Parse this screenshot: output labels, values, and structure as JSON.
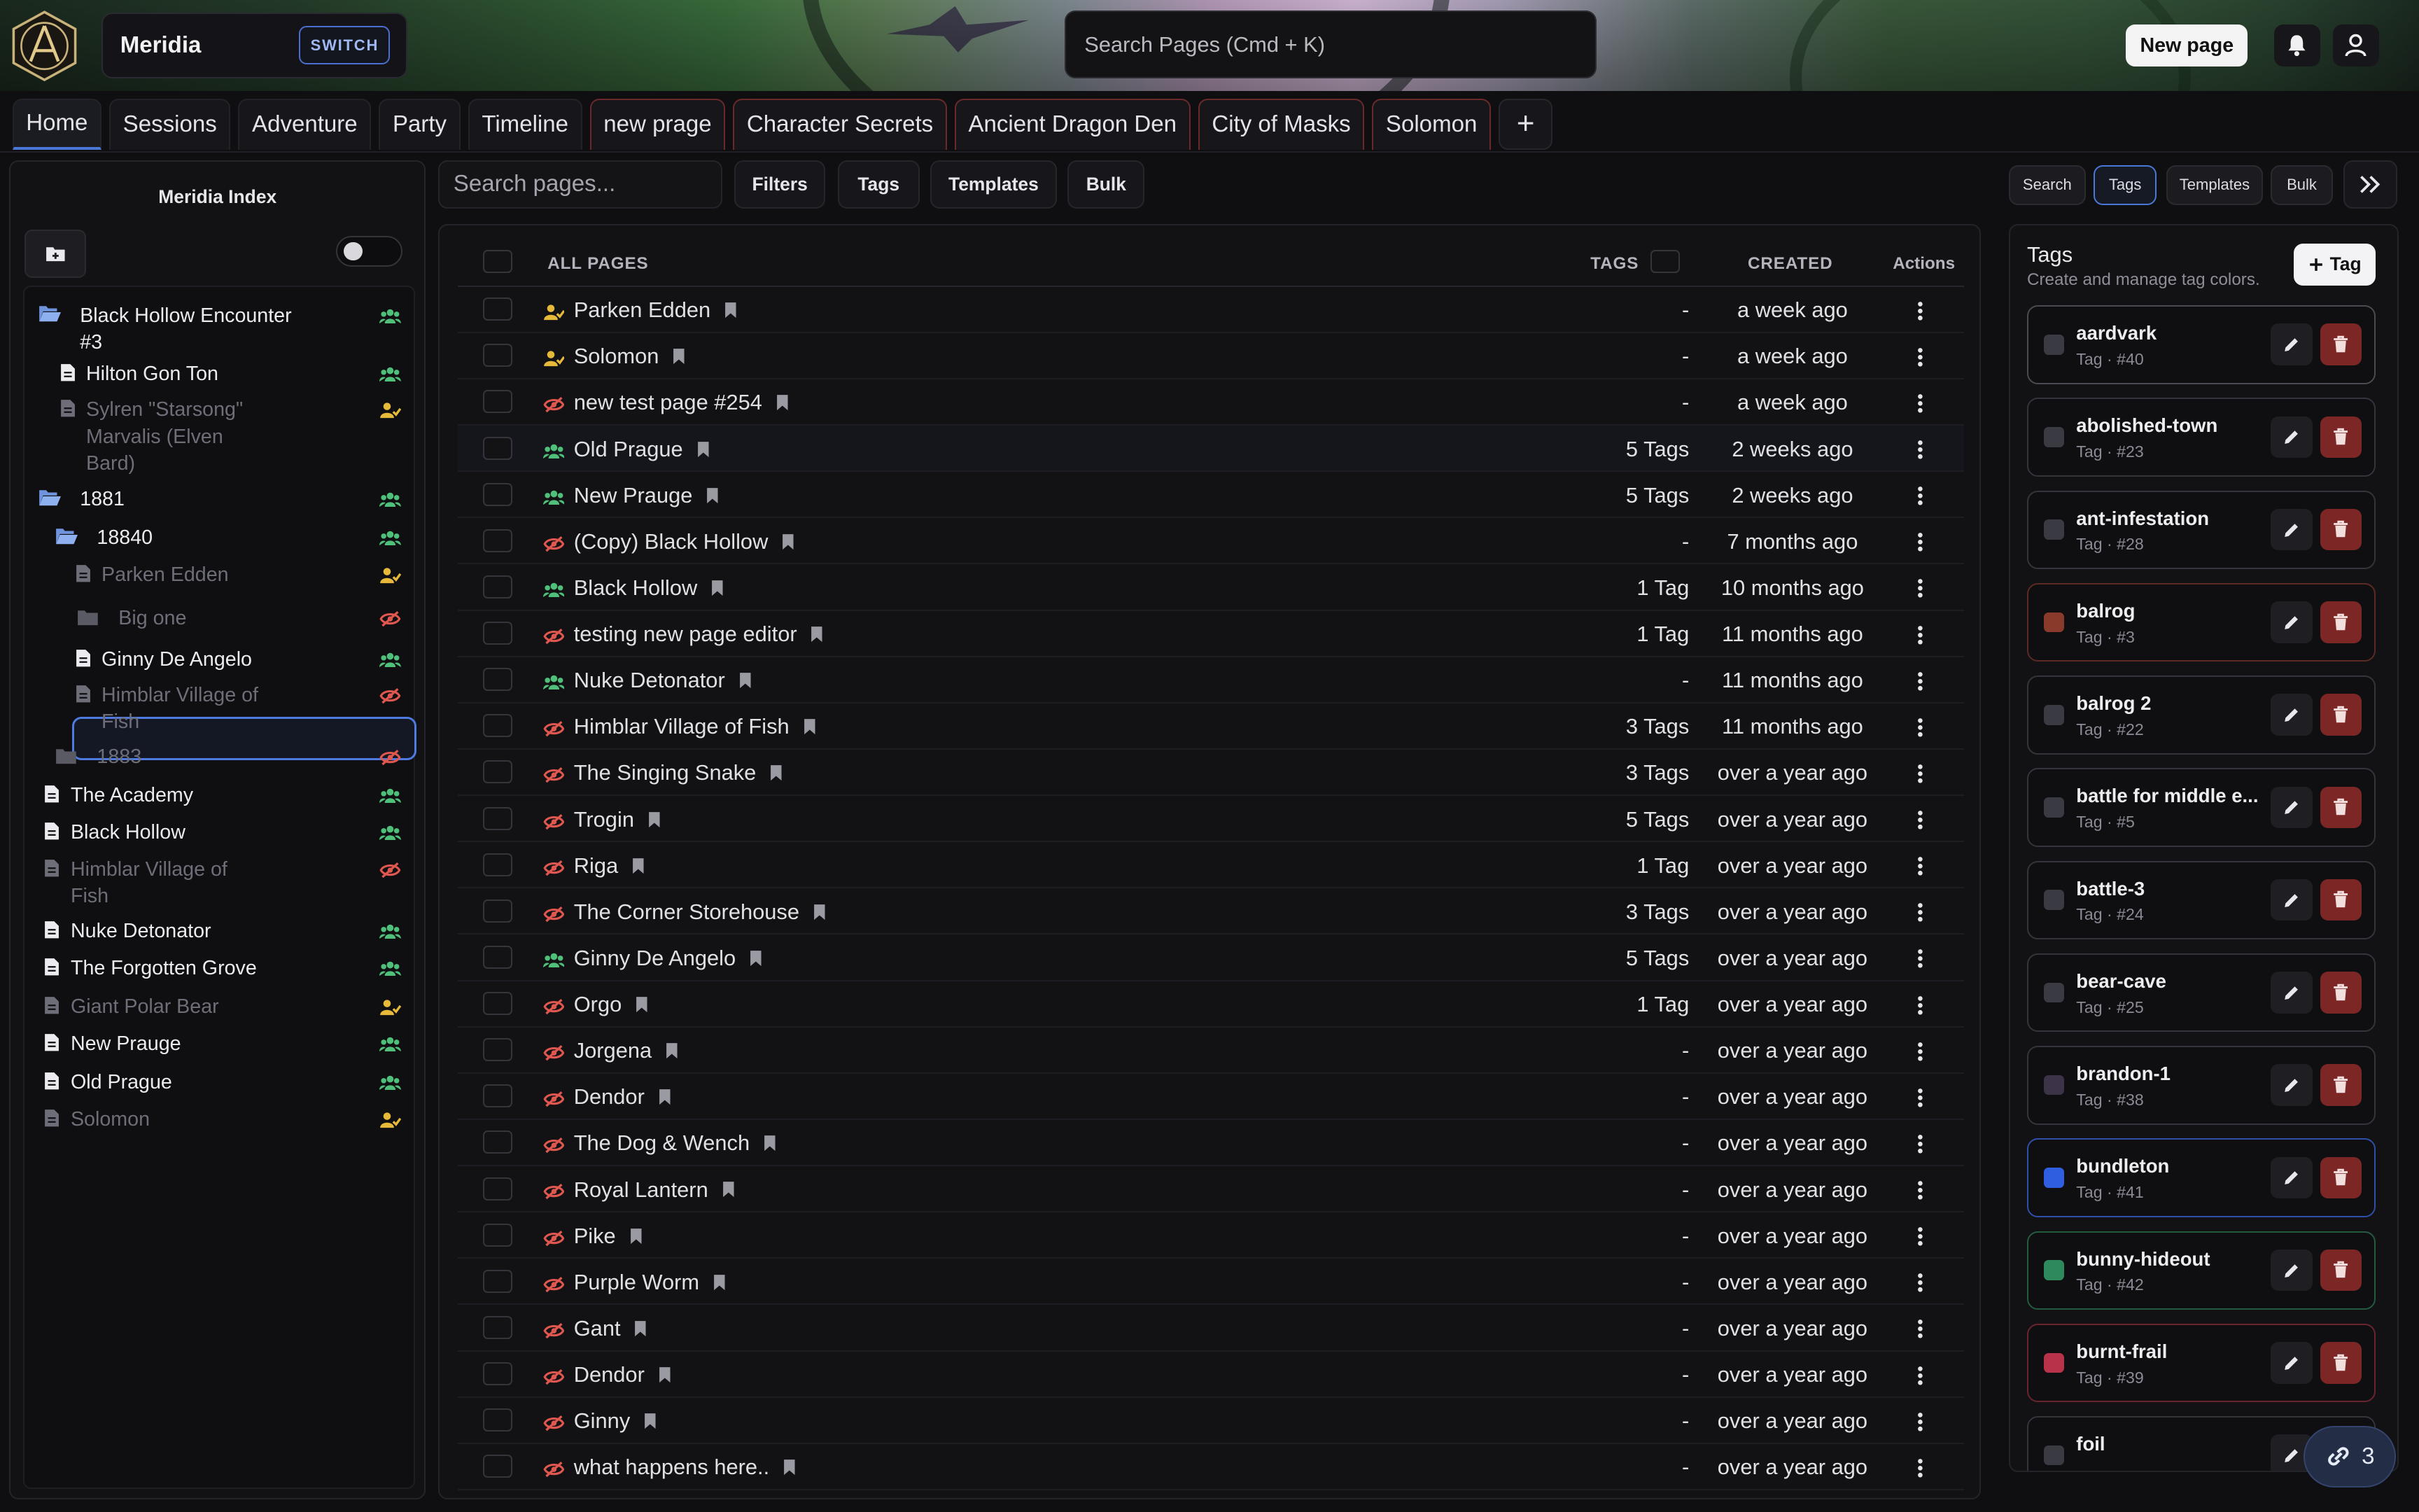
{
  "header": {
    "campaign_name": "Meridia",
    "switch_label": "SWITCH",
    "search_placeholder": "Search Pages (Cmd + K)",
    "new_page_label": "New page",
    "icons": [
      "app-logo-icon",
      "bell-icon",
      "user-icon"
    ]
  },
  "tabs": [
    {
      "label": "Home",
      "active": true
    },
    {
      "label": "Sessions"
    },
    {
      "label": "Adventure"
    },
    {
      "label": "Party"
    },
    {
      "label": "Timeline"
    },
    {
      "label": "new prage",
      "hidden": true
    },
    {
      "label": "Character Secrets",
      "hidden": true
    },
    {
      "label": "Ancient Dragon Den",
      "hidden": true
    },
    {
      "label": "City of Masks",
      "hidden": true
    },
    {
      "label": "Solomon",
      "hidden": true
    }
  ],
  "add_tab_label": "+",
  "sidebar": {
    "title": "Meridia Index",
    "items": [
      {
        "label": "Black Hollow Encounter #3",
        "type": "folder-open",
        "vis": "party",
        "dim": false
      },
      {
        "label": "Hilton Gon Ton",
        "type": "page",
        "vis": "party",
        "dim": false
      },
      {
        "label": "Sylren \"Starsong\" Marvalis (Elven Bard)",
        "type": "page",
        "vis": "user",
        "dim": true
      },
      {
        "label": "1881",
        "type": "folder-open",
        "vis": "party",
        "dim": false
      },
      {
        "label": "18840",
        "type": "folder-open",
        "vis": "party",
        "dim": false
      },
      {
        "label": "Parken Edden",
        "type": "page",
        "vis": "user",
        "dim": true
      },
      {
        "label": "Big one",
        "type": "folder",
        "vis": "hidden",
        "dim": true,
        "selected": true
      },
      {
        "label": "Ginny De Angelo",
        "type": "page",
        "vis": "party",
        "dim": false
      },
      {
        "label": "Himblar Village of Fish",
        "type": "page",
        "vis": "hidden",
        "dim": true
      },
      {
        "label": "1883",
        "type": "folder",
        "vis": "hidden",
        "dim": true
      },
      {
        "label": "The Academy",
        "type": "page",
        "vis": "party",
        "dim": false
      },
      {
        "label": "Black Hollow",
        "type": "page",
        "vis": "party",
        "dim": false
      },
      {
        "label": "Himblar Village of Fish",
        "type": "page",
        "vis": "hidden",
        "dim": true
      },
      {
        "label": "Nuke Detonator",
        "type": "page",
        "vis": "party",
        "dim": false
      },
      {
        "label": "The Forgotten Grove",
        "type": "page",
        "vis": "party",
        "dim": false
      },
      {
        "label": "Giant Polar Bear",
        "type": "page",
        "vis": "user",
        "dim": true
      },
      {
        "label": "New Prauge",
        "type": "page",
        "vis": "party",
        "dim": false
      },
      {
        "label": "Old Prague",
        "type": "page",
        "vis": "party",
        "dim": false
      },
      {
        "label": "Solomon",
        "type": "page",
        "vis": "user",
        "dim": true
      }
    ]
  },
  "toolbar": {
    "search_placeholder": "Search pages...",
    "filters_label": "Filters",
    "tags_label": "Tags",
    "templates_label": "Templates",
    "bulk_label": "Bulk"
  },
  "table": {
    "col_all_pages": "ALL PAGES",
    "col_tags": "TAGS",
    "col_created": "CREATED",
    "col_actions": "Actions",
    "rows": [
      {
        "name": "Parken Edden",
        "vis": "user",
        "tags": "-",
        "created": "a week ago"
      },
      {
        "name": "Solomon",
        "vis": "user",
        "tags": "-",
        "created": "a week ago"
      },
      {
        "name": "new test page #254",
        "vis": "hidden",
        "tags": "-",
        "created": "a week ago"
      },
      {
        "name": "Old Prague",
        "vis": "party",
        "tags": "5 Tags",
        "created": "2 weeks ago"
      },
      {
        "name": "New Prauge",
        "vis": "party",
        "tags": "5 Tags",
        "created": "2 weeks ago"
      },
      {
        "name": "(Copy) Black Hollow",
        "vis": "hidden",
        "tags": "-",
        "created": "7 months ago"
      },
      {
        "name": "Black Hollow",
        "vis": "party",
        "tags": "1 Tag",
        "created": "10 months ago"
      },
      {
        "name": "testing new page editor",
        "vis": "hidden",
        "tags": "1 Tag",
        "created": "11 months ago"
      },
      {
        "name": "Nuke Detonator",
        "vis": "party",
        "tags": "-",
        "created": "11 months ago"
      },
      {
        "name": "Himblar Village of Fish",
        "vis": "hidden",
        "tags": "3 Tags",
        "created": "11 months ago"
      },
      {
        "name": "The Singing Snake",
        "vis": "hidden",
        "tags": "3 Tags",
        "created": "over a year ago"
      },
      {
        "name": "Trogin",
        "vis": "hidden",
        "tags": "5 Tags",
        "created": "over a year ago"
      },
      {
        "name": "Riga",
        "vis": "hidden",
        "tags": "1 Tag",
        "created": "over a year ago"
      },
      {
        "name": "The Corner Storehouse",
        "vis": "hidden",
        "tags": "3 Tags",
        "created": "over a year ago"
      },
      {
        "name": "Ginny De Angelo",
        "vis": "party",
        "tags": "5 Tags",
        "created": "over a year ago"
      },
      {
        "name": "Orgo",
        "vis": "hidden",
        "tags": "1 Tag",
        "created": "over a year ago"
      },
      {
        "name": "Jorgena",
        "vis": "hidden",
        "tags": "-",
        "created": "over a year ago"
      },
      {
        "name": "Dendor",
        "vis": "hidden",
        "tags": "-",
        "created": "over a year ago"
      },
      {
        "name": "The Dog & Wench",
        "vis": "hidden",
        "tags": "-",
        "created": "over a year ago"
      },
      {
        "name": "Royal Lantern",
        "vis": "hidden",
        "tags": "-",
        "created": "over a year ago"
      },
      {
        "name": "Pike",
        "vis": "hidden",
        "tags": "-",
        "created": "over a year ago"
      },
      {
        "name": "Purple Worm",
        "vis": "hidden",
        "tags": "-",
        "created": "over a year ago"
      },
      {
        "name": "Gant",
        "vis": "hidden",
        "tags": "-",
        "created": "over a year ago"
      },
      {
        "name": "Dendor",
        "vis": "hidden",
        "tags": "-",
        "created": "over a year ago"
      },
      {
        "name": "Ginny",
        "vis": "hidden",
        "tags": "-",
        "created": "over a year ago"
      },
      {
        "name": "what happens here..",
        "vis": "hidden",
        "tags": "-",
        "created": "over a year ago"
      }
    ]
  },
  "right_tabs": {
    "search_label": "Search",
    "tags_label": "Tags",
    "templates_label": "Templates",
    "bulk_label": "Bulk"
  },
  "tags_panel": {
    "title": "Tags",
    "subtitle": "Create and manage tag colors.",
    "add_label": "Tag",
    "tags": [
      {
        "name": "aardvark",
        "meta": "Tag · #40",
        "color": "#3a3a42",
        "border": "#4a4a52"
      },
      {
        "name": "abolished-town",
        "meta": "Tag · #23",
        "color": "#3a3a42",
        "border": "#34343c"
      },
      {
        "name": "ant-infestation",
        "meta": "Tag · #28",
        "color": "#3a3a42",
        "border": "#34343c"
      },
      {
        "name": "balrog",
        "meta": "Tag · #3",
        "color": "#8a3a2a",
        "border": "#5c2a24"
      },
      {
        "name": "balrog 2",
        "meta": "Tag · #22",
        "color": "#3a3a42",
        "border": "#34343c"
      },
      {
        "name": "battle for middle e...",
        "meta": "Tag · #5",
        "color": "#3a3a42",
        "border": "#34343c"
      },
      {
        "name": "battle-3",
        "meta": "Tag · #24",
        "color": "#3a3a42",
        "border": "#34343c"
      },
      {
        "name": "bear-cave",
        "meta": "Tag · #25",
        "color": "#3a3a42",
        "border": "#34343c"
      },
      {
        "name": "brandon-1",
        "meta": "Tag · #38",
        "color": "#3d3348",
        "border": "#34343c"
      },
      {
        "name": "bundleton",
        "meta": "Tag · #41",
        "color": "#2f5fe0",
        "border": "#2f4fa8"
      },
      {
        "name": "bunny-hideout",
        "meta": "Tag · #42",
        "color": "#2e8a5c",
        "border": "#245a40"
      },
      {
        "name": "burnt-frail",
        "meta": "Tag · #39",
        "color": "#b8324a",
        "border": "#6a2430"
      },
      {
        "name": "foil",
        "meta": "",
        "color": "#3a3a42",
        "border": "#34343c"
      }
    ]
  },
  "links_count": "3"
}
